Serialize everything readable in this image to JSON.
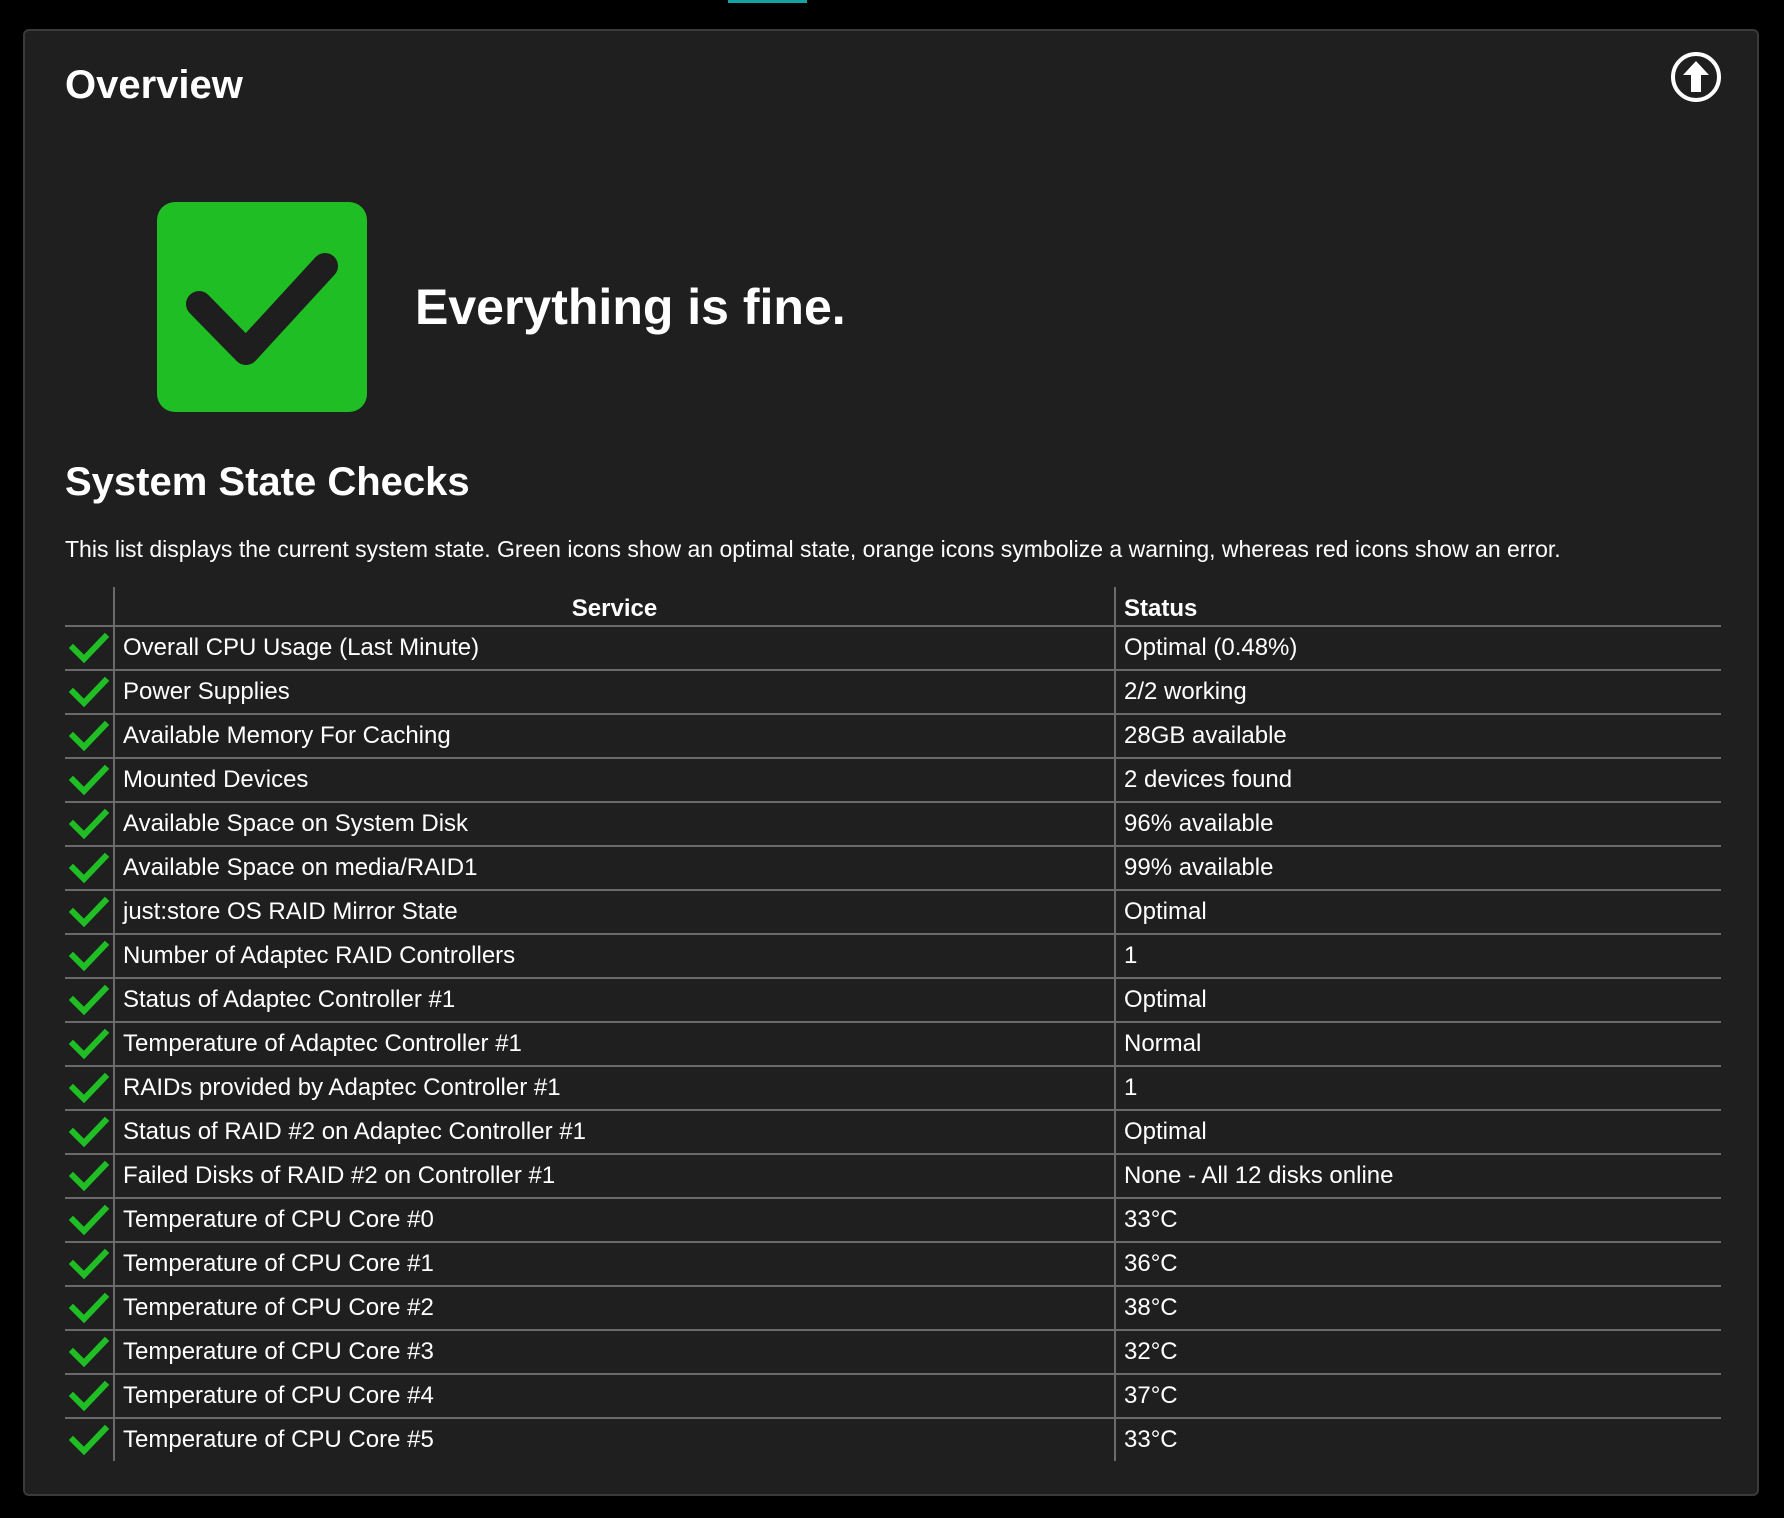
{
  "colors": {
    "ok": "#1fbe24",
    "accent": "#17a2a2",
    "panel_bg": "#1f1f1f"
  },
  "overview": {
    "title": "Overview",
    "upload_icon": "arrow-up-circle-icon",
    "state_icon": "checkmark-icon",
    "state_message": "Everything is fine."
  },
  "system_checks": {
    "title": "System State Checks",
    "description": "This list displays the current system state. Green icons show an optimal state, orange icons symbolize a warning, whereas red icons show an error.",
    "columns": {
      "service": "Service",
      "status": "Status"
    },
    "rows": [
      {
        "state": "ok",
        "service": "Overall CPU Usage (Last Minute)",
        "status": "Optimal (0.48%)"
      },
      {
        "state": "ok",
        "service": "Power Supplies",
        "status": "2/2 working"
      },
      {
        "state": "ok",
        "service": "Available Memory For Caching",
        "status": "28GB available"
      },
      {
        "state": "ok",
        "service": "Mounted Devices",
        "status": "2 devices found"
      },
      {
        "state": "ok",
        "service": "Available Space on System Disk",
        "status": "96% available"
      },
      {
        "state": "ok",
        "service": "Available Space on media/RAID1",
        "status": "99% available"
      },
      {
        "state": "ok",
        "service": "just:store OS RAID Mirror State",
        "status": "Optimal"
      },
      {
        "state": "ok",
        "service": "Number of Adaptec RAID Controllers",
        "status": "1"
      },
      {
        "state": "ok",
        "service": "Status of Adaptec Controller #1",
        "status": "Optimal"
      },
      {
        "state": "ok",
        "service": "Temperature of Adaptec Controller #1",
        "status": "Normal"
      },
      {
        "state": "ok",
        "service": "RAIDs provided by Adaptec Controller #1",
        "status": "1"
      },
      {
        "state": "ok",
        "service": "Status of RAID #2 on Adaptec Controller #1",
        "status": "Optimal"
      },
      {
        "state": "ok",
        "service": "Failed Disks of RAID #2 on Controller #1",
        "status": "None - All 12 disks online"
      },
      {
        "state": "ok",
        "service": "Temperature of CPU Core #0",
        "status": "33°C"
      },
      {
        "state": "ok",
        "service": "Temperature of CPU Core #1",
        "status": "36°C"
      },
      {
        "state": "ok",
        "service": "Temperature of CPU Core #2",
        "status": "38°C"
      },
      {
        "state": "ok",
        "service": "Temperature of CPU Core #3",
        "status": "32°C"
      },
      {
        "state": "ok",
        "service": "Temperature of CPU Core #4",
        "status": "37°C"
      },
      {
        "state": "ok",
        "service": "Temperature of CPU Core #5",
        "status": "33°C"
      }
    ]
  }
}
